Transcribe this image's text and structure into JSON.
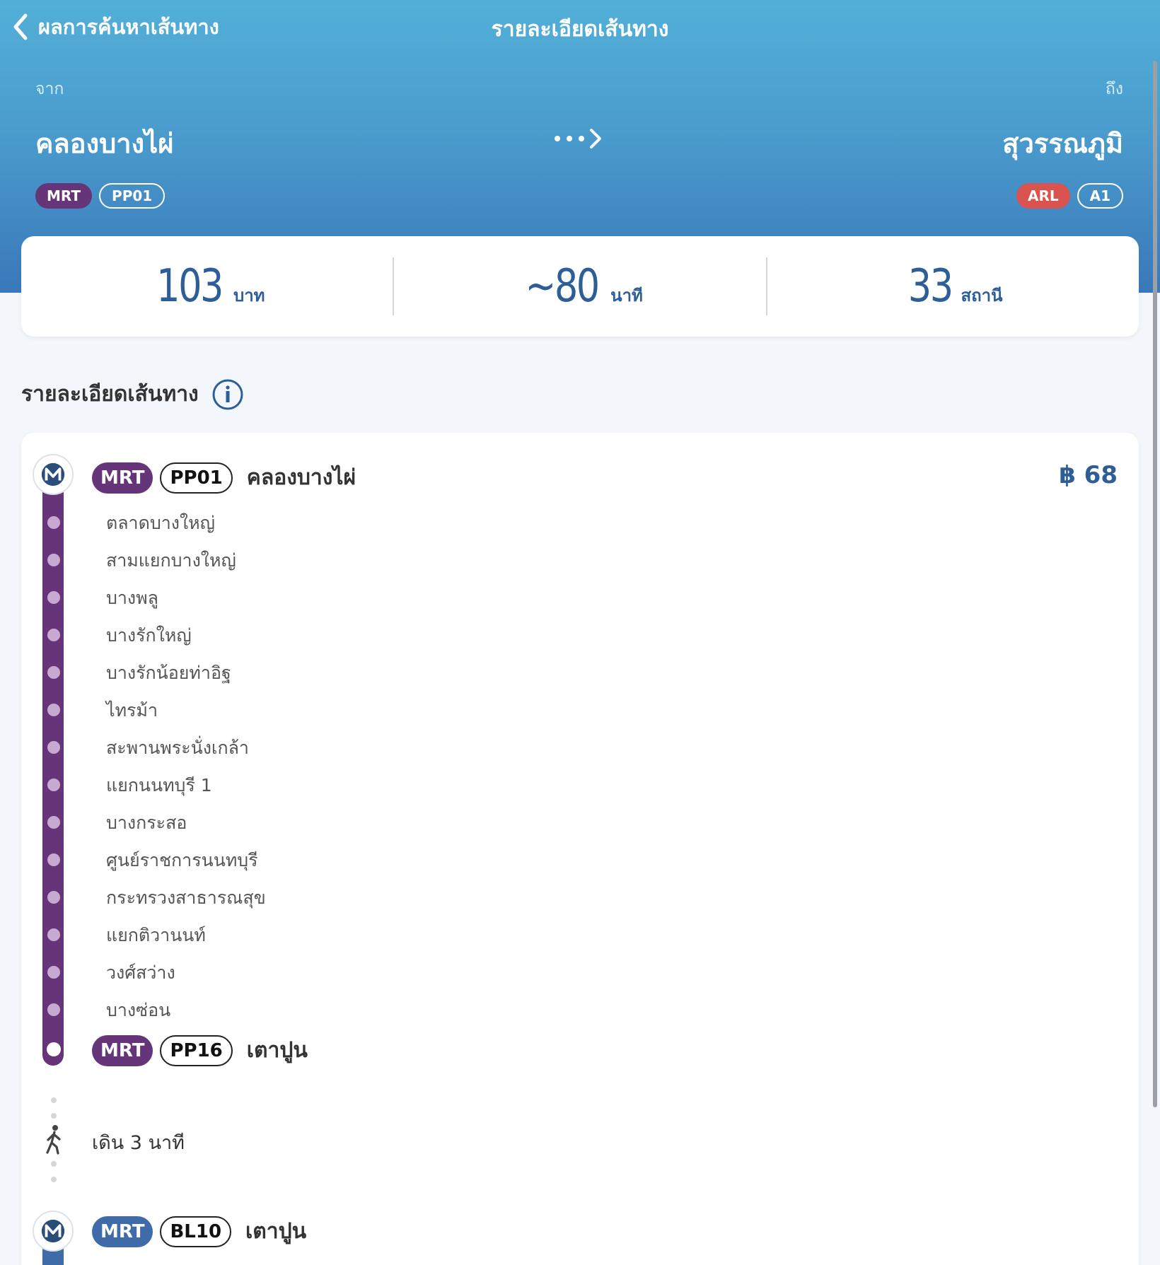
{
  "nav": {
    "back_label": "ผลการค้นหาเส้นทาง",
    "title": "รายละเอียดเส้นทาง"
  },
  "trip": {
    "from_caption": "จาก",
    "to_caption": "ถึง",
    "from_station": "คลองบางไผ่",
    "to_station": "สุวรรณภูมิ",
    "from_line": "MRT",
    "from_code": "PP01",
    "to_line": "ARL",
    "to_code": "A1"
  },
  "summary": {
    "fare": "103",
    "fare_unit": "บาท",
    "duration": "~80",
    "duration_unit": "นาที",
    "stations": "33",
    "stations_unit": "สถานี"
  },
  "section": {
    "title": "รายละเอียดเส้นทาง"
  },
  "segments": [
    {
      "line": "MRT",
      "start_code": "PP01",
      "start_station": "คลองบางไผ่",
      "fare": "฿ 68",
      "stops": [
        "ตลาดบางใหญ่",
        "สามแยกบางใหญ่",
        "บางพลู",
        "บางรักใหญ่",
        "บางรักน้อยท่าอิฐ",
        "ไทรม้า",
        "สะพานพระนั่งเกล้า",
        "แยกนนทบุรี 1",
        "บางกระสอ",
        "ศูนย์ราชการนนทบุรี",
        "กระทรวงสาธารณสุข",
        "แยกติวานนท์",
        "วงศ์สว่าง",
        "บางซ่อน"
      ],
      "end_line": "MRT",
      "end_code": "PP16",
      "end_station": "เตาปูน"
    },
    {
      "line": "MRT",
      "start_code": "BL10",
      "start_station": "เตาปูน"
    }
  ],
  "walk": {
    "label": "เดิน 3 นาที"
  },
  "colors": {
    "purple_line": "#663478",
    "blue_line": "#3f6ba8",
    "arl": "#d9534f",
    "accent": "#2d5e97"
  }
}
